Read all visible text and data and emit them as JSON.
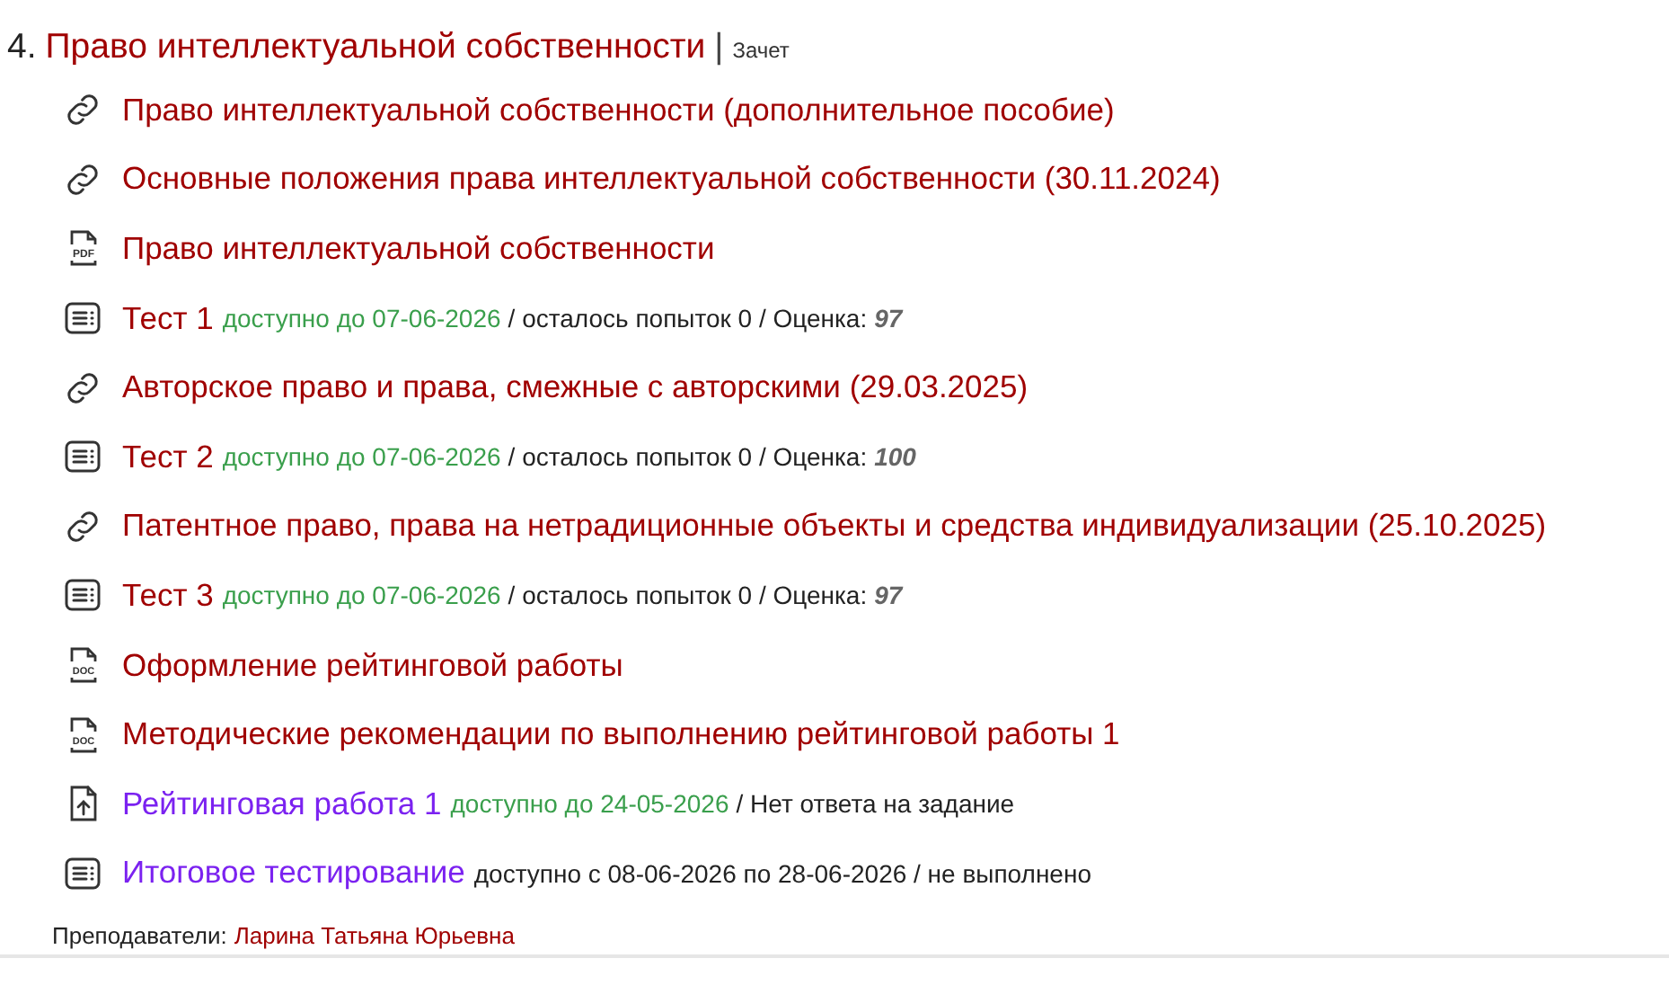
{
  "section": {
    "number": "4.",
    "title": "Право интеллектуальной собственности",
    "separator": "|",
    "assessment": "Зачет"
  },
  "items": [
    {
      "kind": "link",
      "title": "Право интеллектуальной собственности (дополнительное пособие)",
      "highlighted": false
    },
    {
      "kind": "link",
      "title": "Основные положения права интеллектуальной собственности (30.11.2024)",
      "highlighted": false
    },
    {
      "kind": "pdf",
      "icon_text": "PDF",
      "title": "Право интеллектуальной собственности",
      "highlighted": false
    },
    {
      "kind": "test",
      "title": "Тест 1",
      "highlighted": false,
      "deadline": "доступно до 07-06-2026",
      "details": "/ осталось попыток 0 / Оценка:",
      "score": "97"
    },
    {
      "kind": "link",
      "title": "Авторское право и права, смежные с авторскими (29.03.2025)",
      "highlighted": false
    },
    {
      "kind": "test",
      "title": "Тест 2",
      "highlighted": false,
      "deadline": "доступно до 07-06-2026",
      "details": "/ осталось попыток 0 / Оценка:",
      "score": "100"
    },
    {
      "kind": "link",
      "title": "Патентное право, права на нетрадиционные объекты и средства индивидуализации (25.10.2025)",
      "highlighted": false
    },
    {
      "kind": "test",
      "title": "Тест 3",
      "highlighted": false,
      "deadline": "доступно до 07-06-2026",
      "details": "/ осталось попыток 0 / Оценка:",
      "score": "97"
    },
    {
      "kind": "doc",
      "icon_text": "DOC",
      "title": "Оформление рейтинговой работы",
      "highlighted": false
    },
    {
      "kind": "doc",
      "icon_text": "DOC",
      "title": "Методические рекомендации по выполнению рейтинговой работы 1",
      "highlighted": false
    },
    {
      "kind": "upload",
      "title": "Рейтинговая работа 1",
      "highlighted": true,
      "deadline": "доступно до 24-05-2026",
      "details": "/ Нет ответа на задание"
    },
    {
      "kind": "test",
      "title": "Итоговое тестирование",
      "highlighted": true,
      "details": "доступно с 08-06-2026 по 28-06-2026 / не выполнено"
    }
  ],
  "teachers": {
    "label": "Преподаватели:",
    "name": "Ларина Татьяна Юрьевна"
  }
}
